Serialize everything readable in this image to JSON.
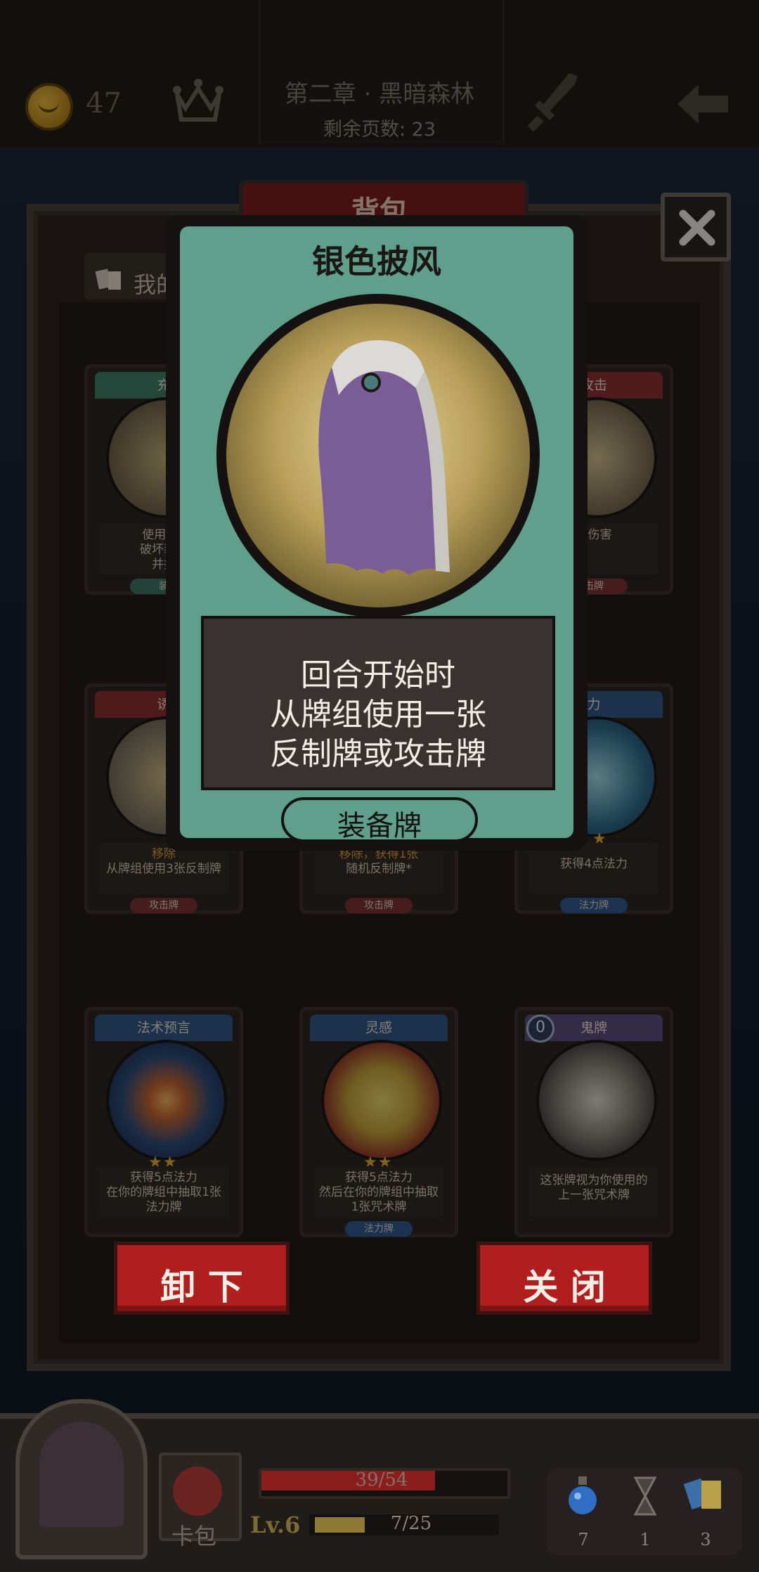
{
  "top_bar": {
    "gold": "47",
    "chapter_title": "第二章 · 黑暗森林",
    "pages_left": "剩余页数: 23"
  },
  "panel": {
    "title": "背包",
    "tab_label": "我的"
  },
  "cards": [
    {
      "name": "充",
      "desc": [
        "使用2张",
        "破坏装备",
        "并抽"
      ],
      "type": "装",
      "theme": "green"
    },
    {
      "name": "攻击",
      "desc": [
        "点伤害"
      ],
      "type": "击牌",
      "theme": "red"
    },
    {
      "name": "诱",
      "desc_highlight": "移除",
      "desc": [
        "从牌组使用3张反制牌"
      ],
      "type": "攻击牌",
      "theme": "red"
    },
    {
      "name": "",
      "desc_highlight": "移除，获得1张",
      "desc": [
        "随机反制牌*"
      ],
      "type": "攻击牌",
      "theme": "red"
    },
    {
      "name": "力",
      "desc": [
        "获得4点法力"
      ],
      "type": "法力牌",
      "theme": "blue"
    },
    {
      "name": "法术预言",
      "desc": [
        "获得5点法力",
        "在你的牌组中抽取1张",
        "法力牌"
      ],
      "type": "",
      "stars": "★★",
      "theme": "blue"
    },
    {
      "name": "灵感",
      "desc": [
        "获得5点法力",
        "然后在你的牌组中抽取",
        "1张咒术牌"
      ],
      "type": "法力牌",
      "stars": "★★",
      "theme": "blue"
    },
    {
      "name": "鬼牌",
      "cost": "0",
      "desc": [
        "这张牌视为你使用的",
        "上一张咒术牌"
      ],
      "type": "",
      "theme": "purple"
    }
  ],
  "modal_card": {
    "title": "银色披风",
    "description_lines": [
      "回合开始时",
      "从牌组使用一张",
      "反制牌或攻击牌"
    ],
    "type": "装备牌"
  },
  "buttons": {
    "unequip": "卸 下",
    "close": "关 闭"
  },
  "hud": {
    "hp_text": "39/54",
    "hp_fraction": 0.722,
    "level": "Lv.6",
    "xp_text": "7/25",
    "xp_fraction": 0.28,
    "card_pack_label": "卡包",
    "resources": [
      {
        "icon": "potion-icon",
        "count": "7"
      },
      {
        "icon": "hourglass-icon",
        "count": "1"
      },
      {
        "icon": "cards-icon",
        "count": "3"
      }
    ]
  }
}
